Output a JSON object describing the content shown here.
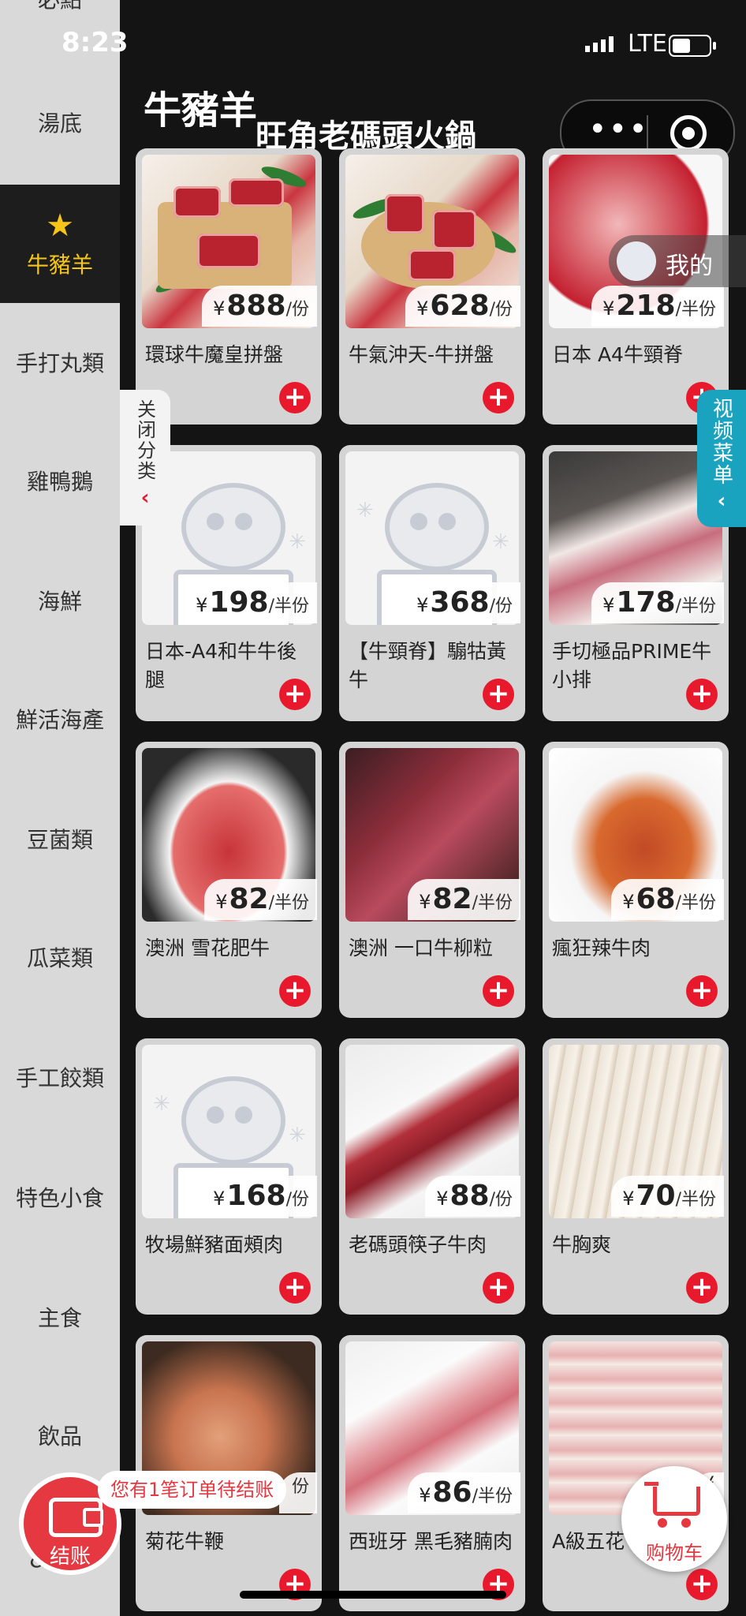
{
  "status": {
    "time": "8:23",
    "network": "LTE"
  },
  "header": {
    "title": "牛豬羊",
    "store_name": "旺角老碼頭火鍋"
  },
  "sidebar": {
    "partial_top": "必點",
    "categories": [
      {
        "label": "湯底"
      },
      {
        "label": "牛豬羊",
        "active": true
      },
      {
        "label": "手打丸類"
      },
      {
        "label": "雞鴨鵝"
      },
      {
        "label": "海鮮"
      },
      {
        "label": "鮮活海產"
      },
      {
        "label": "豆菌類"
      },
      {
        "label": "瓜菜類"
      },
      {
        "label": "手工餃類"
      },
      {
        "label": "特色小食"
      },
      {
        "label": "主食"
      },
      {
        "label": "飲品"
      },
      {
        "label": "&甜品"
      }
    ]
  },
  "products": [
    {
      "name": "環球牛魔皇拼盤",
      "currency": "¥",
      "price": "888",
      "unit": "/份"
    },
    {
      "name": "牛氣沖天-牛拼盤",
      "currency": "¥",
      "price": "628",
      "unit": "/份"
    },
    {
      "name": "日本 A4牛頸脊",
      "currency": "¥",
      "price": "218",
      "unit": "/半份"
    },
    {
      "name": "日本-A4和牛牛後腿",
      "currency": "¥",
      "price": "198",
      "unit": "/半份"
    },
    {
      "name": "【牛頸脊】騸牯黃牛",
      "currency": "¥",
      "price": "368",
      "unit": "/份"
    },
    {
      "name": "手切極品PRIME牛小排",
      "currency": "¥",
      "price": "178",
      "unit": "/半份"
    },
    {
      "name": "澳洲 雪花肥牛",
      "currency": "¥",
      "price": "82",
      "unit": "/半份"
    },
    {
      "name": "澳洲 一口牛柳粒",
      "currency": "¥",
      "price": "82",
      "unit": "/半份"
    },
    {
      "name": "瘋狂辣牛肉",
      "currency": "¥",
      "price": "68",
      "unit": "/半份"
    },
    {
      "name": "牧場鮮豬面頰肉",
      "currency": "¥",
      "price": "168",
      "unit": "/份"
    },
    {
      "name": "老碼頭筷子牛肉",
      "currency": "¥",
      "price": "88",
      "unit": "/份"
    },
    {
      "name": "牛胸爽",
      "currency": "¥",
      "price": "70",
      "unit": "/半份"
    },
    {
      "name": "菊花牛鞭",
      "currency": "",
      "price": "",
      "unit": "份"
    },
    {
      "name": "西班牙 黑毛豬腩肉",
      "currency": "¥",
      "price": "86",
      "unit": "/半份"
    },
    {
      "name": "A級五花",
      "currency": "¥",
      "price": "",
      "unit": ""
    }
  ],
  "add_icon": "+",
  "overlays": {
    "close_category": "关闭分类",
    "video_menu": "视频菜单",
    "mine": "我的",
    "pending_order": "您有1笔订单待结账",
    "checkout": "结账",
    "cart": "购物车"
  },
  "colors": {
    "accent_red": "#e8192c",
    "active_yellow": "#f5c518",
    "video_teal": "#19a3be"
  }
}
